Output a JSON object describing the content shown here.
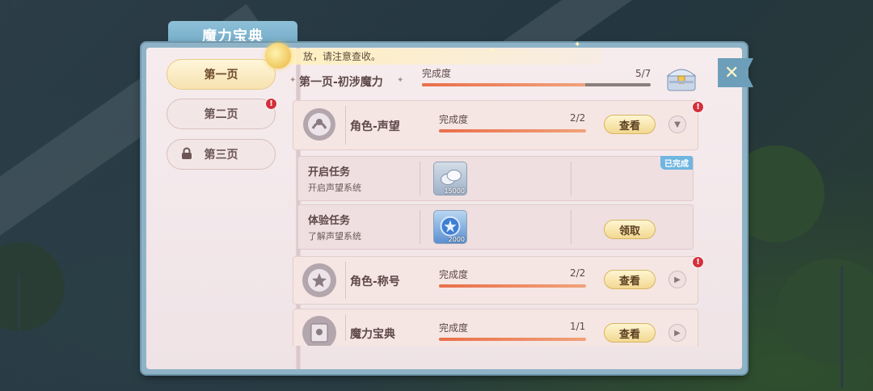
{
  "window": {
    "title": "魔力宝典"
  },
  "notice": {
    "text": "放，请注意查收。"
  },
  "page_tabs": [
    {
      "label": "第一页",
      "active": true,
      "badge": false,
      "locked": false
    },
    {
      "label": "第二页",
      "active": false,
      "badge": true,
      "locked": false
    },
    {
      "label": "第三页",
      "active": false,
      "badge": false,
      "locked": true
    }
  ],
  "section": {
    "title": "第一页-初涉魔力",
    "progress_label": "完成度",
    "progress_value": "5/7",
    "progress_fraction": 0.714
  },
  "tasks": [
    {
      "name": "角色-声望",
      "progress_label": "完成度",
      "progress_value": "2/2",
      "progress_fraction": 1.0,
      "button": "查看",
      "badge": true,
      "expanded": true,
      "subtasks": [
        {
          "name": "开启任务",
          "desc": "开启声望系统",
          "reward_qty": "15000",
          "reward_icon": "silver-coin-icon",
          "status": "已完成",
          "action": ""
        },
        {
          "name": "体验任务",
          "desc": "了解声望系统",
          "reward_qty": "2000",
          "reward_icon": "star-gem-icon",
          "status": "",
          "action": "领取"
        }
      ]
    },
    {
      "name": "角色-称号",
      "progress_label": "完成度",
      "progress_value": "2/2",
      "progress_fraction": 1.0,
      "button": "查看",
      "badge": true,
      "expanded": false
    },
    {
      "name": "魔力宝典",
      "progress_label": "完成度",
      "progress_value": "1/1",
      "progress_fraction": 1.0,
      "button": "查看",
      "badge": false,
      "expanded": false
    }
  ],
  "colors": {
    "progress_fill": "#e96f4a",
    "badge": "#d4303c",
    "done_tag": "#6eb6e0",
    "frame": "#8fb3c6"
  }
}
